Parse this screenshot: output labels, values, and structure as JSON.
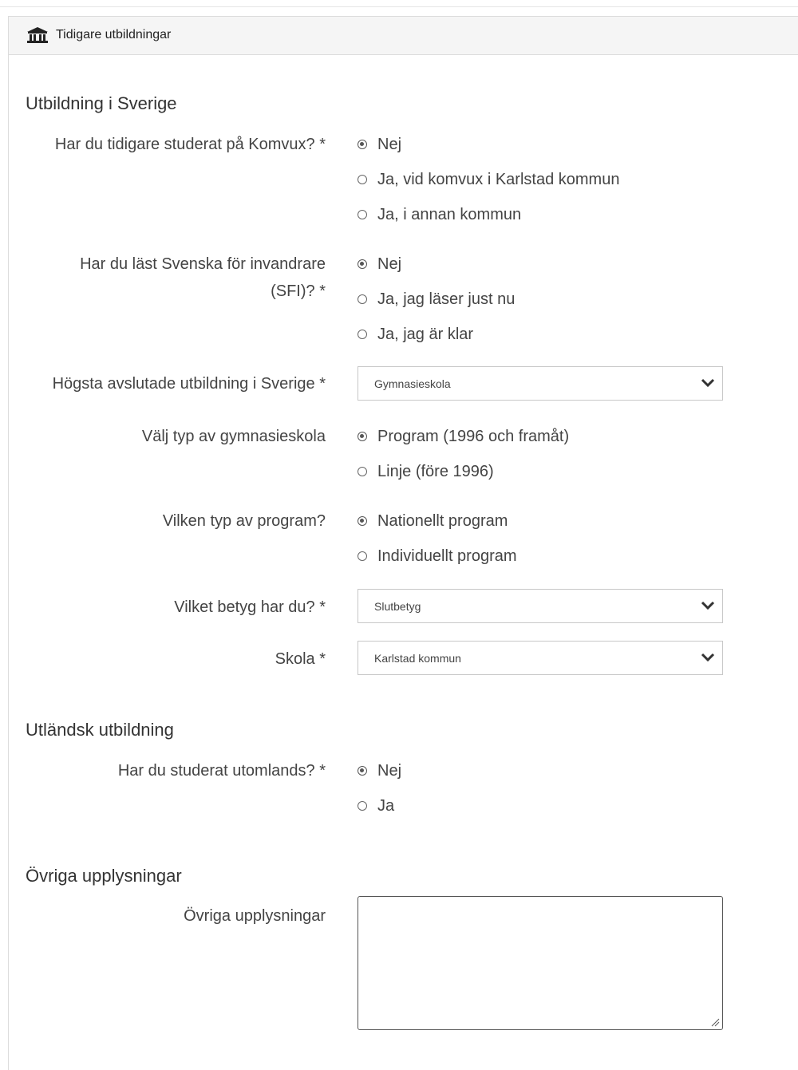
{
  "panel": {
    "title": "Tidigare utbildningar",
    "icon": "bank-icon"
  },
  "sections": {
    "sweden": "Utbildning i Sverige",
    "abroad": "Utländsk utbildning",
    "other": "Övriga upplysningar"
  },
  "q_komvux": {
    "label": "Har du tidigare studerat på Komvux? *",
    "options": [
      "Nej",
      "Ja, vid komvux i Karlstad kommun",
      "Ja, i annan kommun"
    ],
    "selected": "Nej"
  },
  "q_sfi": {
    "label_line1": "Har du läst Svenska för invandrare",
    "label_line2": "(SFI)? *",
    "options": [
      "Nej",
      "Ja, jag läser just nu",
      "Ja, jag är klar"
    ],
    "selected": "Nej"
  },
  "q_highest": {
    "label": "Högsta avslutade utbildning i Sverige *",
    "value": "Gymnasieskola"
  },
  "q_school_type": {
    "label": "Välj typ av gymnasieskola",
    "options": [
      "Program (1996 och framåt)",
      "Linje (före 1996)"
    ],
    "selected": "Program (1996 och framåt)"
  },
  "q_program_type": {
    "label": "Vilken typ av program?",
    "options": [
      "Nationellt program",
      "Individuellt program"
    ],
    "selected": "Nationellt program"
  },
  "q_grade": {
    "label": "Vilket betyg har du? *",
    "value": "Slutbetyg"
  },
  "q_school": {
    "label": "Skola *",
    "value": "Karlstad kommun"
  },
  "q_abroad": {
    "label": "Har du studerat utomlands? *",
    "options": [
      "Nej",
      "Ja"
    ],
    "selected": "Nej"
  },
  "q_other": {
    "label": "Övriga upplysningar",
    "value": ""
  }
}
